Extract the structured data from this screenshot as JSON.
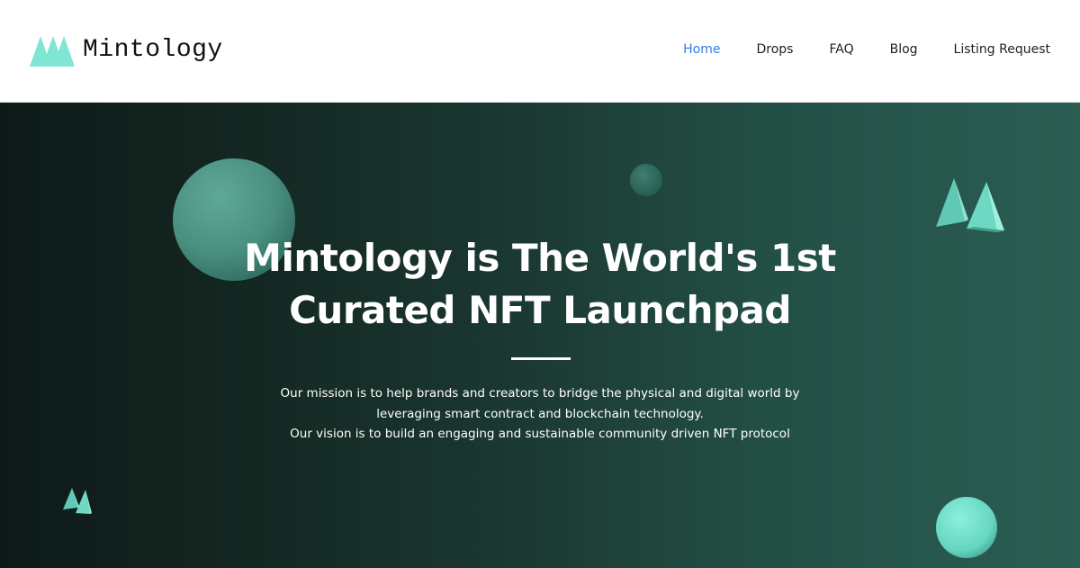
{
  "header": {
    "brand": "Mintology",
    "nav": [
      {
        "label": "Home",
        "active": true
      },
      {
        "label": "Drops",
        "active": false
      },
      {
        "label": "FAQ",
        "active": false
      },
      {
        "label": "Blog",
        "active": false
      },
      {
        "label": "Listing Request",
        "active": false
      }
    ]
  },
  "hero": {
    "title_line1": "Mintology is The World's 1st",
    "title_line2": "Curated NFT Launchpad",
    "text_line1": "Our mission is to help brands and creators to bridge the physical and digital world by",
    "text_line2": "leveraging smart contract and blockchain technology.",
    "text_line3": "Our vision is to build an engaging and sustainable community driven NFT protocol"
  },
  "colors": {
    "accent": "#7ee6d2",
    "nav_active": "#2f7fe0",
    "hero_dark": "#0d1a18",
    "hero_teal": "#2b5d52"
  },
  "icons": {
    "logo": "mintology-logo-icon",
    "decor": [
      "sphere-decor",
      "mintology-mark-decor"
    ]
  }
}
